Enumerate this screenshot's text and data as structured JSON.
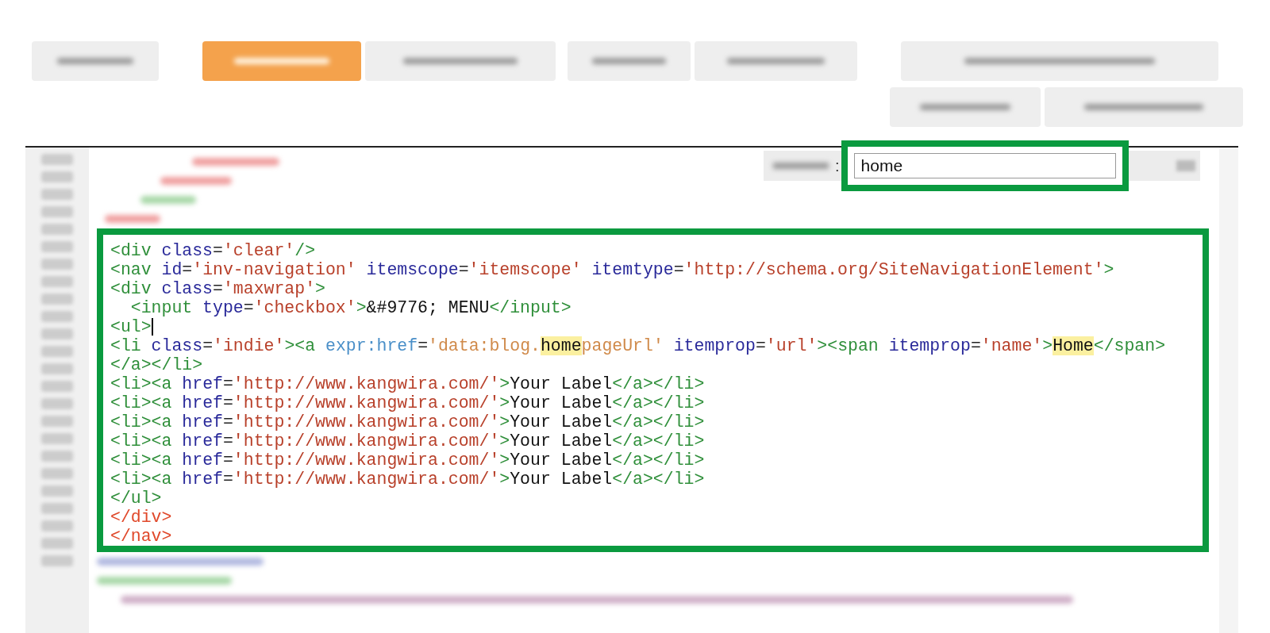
{
  "toolbar": {
    "buttons": [
      {
        "selected": false
      },
      {
        "selected": true
      },
      {
        "selected": false
      },
      {
        "selected": false
      },
      {
        "selected": false
      },
      {
        "selected": false
      }
    ],
    "second_row": [
      {
        "selected": false
      },
      {
        "selected": false
      }
    ]
  },
  "search": {
    "separator": ":",
    "value": "home"
  },
  "code_lines": [
    {
      "cursor": false,
      "tokens": [
        {
          "kind": "tag",
          "text": "<div"
        },
        {
          "kind": "attr",
          "text": " class"
        },
        {
          "kind": "punct",
          "text": "="
        },
        {
          "kind": "string",
          "text": "'clear'"
        },
        {
          "kind": "tag",
          "text": "/>"
        }
      ]
    },
    {
      "cursor": false,
      "tokens": [
        {
          "kind": "tag",
          "text": "<nav"
        },
        {
          "kind": "attr",
          "text": " id"
        },
        {
          "kind": "punct",
          "text": "="
        },
        {
          "kind": "string",
          "text": "'inv-navigation'"
        },
        {
          "kind": "attr",
          "text": " itemscope"
        },
        {
          "kind": "punct",
          "text": "="
        },
        {
          "kind": "string",
          "text": "'itemscope'"
        },
        {
          "kind": "attr",
          "text": " itemtype"
        },
        {
          "kind": "punct",
          "text": "="
        },
        {
          "kind": "string",
          "text": "'http://schema.org/SiteNavigationElement'"
        },
        {
          "kind": "tag",
          "text": ">"
        }
      ]
    },
    {
      "cursor": false,
      "tokens": [
        {
          "kind": "tag",
          "text": "<div"
        },
        {
          "kind": "attr",
          "text": " class"
        },
        {
          "kind": "punct",
          "text": "="
        },
        {
          "kind": "string",
          "text": "'maxwrap'"
        },
        {
          "kind": "tag",
          "text": ">"
        }
      ]
    },
    {
      "cursor": false,
      "tokens": [
        {
          "kind": "tag",
          "text": "  <input"
        },
        {
          "kind": "attr",
          "text": " type"
        },
        {
          "kind": "punct",
          "text": "="
        },
        {
          "kind": "string",
          "text": "'checkbox'"
        },
        {
          "kind": "tag",
          "text": ">"
        },
        {
          "kind": "text",
          "text": "&#9776; MENU"
        },
        {
          "kind": "tag",
          "text": "</input>"
        }
      ]
    },
    {
      "cursor": true,
      "tokens": [
        {
          "kind": "tag",
          "text": "<ul>"
        }
      ]
    },
    {
      "cursor": false,
      "tokens": [
        {
          "kind": "tag",
          "text": "<li"
        },
        {
          "kind": "attr",
          "text": " class"
        },
        {
          "kind": "punct",
          "text": "="
        },
        {
          "kind": "string",
          "text": "'indie'"
        },
        {
          "kind": "tag",
          "text": "><a"
        },
        {
          "kind": "expr",
          "text": " expr:href"
        },
        {
          "kind": "punct",
          "text": "="
        },
        {
          "kind": "expr_string",
          "text": "'data:blog."
        },
        {
          "kind": "match",
          "text": "home"
        },
        {
          "kind": "expr_string",
          "text": "pageUrl'"
        },
        {
          "kind": "attr",
          "text": " itemprop"
        },
        {
          "kind": "punct",
          "text": "="
        },
        {
          "kind": "string",
          "text": "'url'"
        },
        {
          "kind": "tag",
          "text": "><span"
        },
        {
          "kind": "attr",
          "text": " itemprop"
        },
        {
          "kind": "punct",
          "text": "="
        },
        {
          "kind": "string",
          "text": "'name'"
        },
        {
          "kind": "tag",
          "text": ">"
        },
        {
          "kind": "match",
          "text": "Home"
        },
        {
          "kind": "tag",
          "text": "</span>"
        }
      ]
    },
    {
      "cursor": false,
      "tokens": [
        {
          "kind": "tag",
          "text": "</a></li>"
        }
      ]
    },
    {
      "cursor": false,
      "tokens": [
        {
          "kind": "tag",
          "text": "<li><a"
        },
        {
          "kind": "attr",
          "text": " href"
        },
        {
          "kind": "punct",
          "text": "="
        },
        {
          "kind": "string",
          "text": "'http://www.kangwira.com/'"
        },
        {
          "kind": "tag",
          "text": ">"
        },
        {
          "kind": "text",
          "text": "Your Label"
        },
        {
          "kind": "tag",
          "text": "</a></li>"
        }
      ]
    },
    {
      "cursor": false,
      "tokens": [
        {
          "kind": "tag",
          "text": "<li><a"
        },
        {
          "kind": "attr",
          "text": " href"
        },
        {
          "kind": "punct",
          "text": "="
        },
        {
          "kind": "string",
          "text": "'http://www.kangwira.com/'"
        },
        {
          "kind": "tag",
          "text": ">"
        },
        {
          "kind": "text",
          "text": "Your Label"
        },
        {
          "kind": "tag",
          "text": "</a></li>"
        }
      ]
    },
    {
      "cursor": false,
      "tokens": [
        {
          "kind": "tag",
          "text": "<li><a"
        },
        {
          "kind": "attr",
          "text": " href"
        },
        {
          "kind": "punct",
          "text": "="
        },
        {
          "kind": "string",
          "text": "'http://www.kangwira.com/'"
        },
        {
          "kind": "tag",
          "text": ">"
        },
        {
          "kind": "text",
          "text": "Your Label"
        },
        {
          "kind": "tag",
          "text": "</a></li>"
        }
      ]
    },
    {
      "cursor": false,
      "tokens": [
        {
          "kind": "tag",
          "text": "<li><a"
        },
        {
          "kind": "attr",
          "text": " href"
        },
        {
          "kind": "punct",
          "text": "="
        },
        {
          "kind": "string",
          "text": "'http://www.kangwira.com/'"
        },
        {
          "kind": "tag",
          "text": ">"
        },
        {
          "kind": "text",
          "text": "Your Label"
        },
        {
          "kind": "tag",
          "text": "</a></li>"
        }
      ]
    },
    {
      "cursor": false,
      "tokens": [
        {
          "kind": "tag",
          "text": "<li><a"
        },
        {
          "kind": "attr",
          "text": " href"
        },
        {
          "kind": "punct",
          "text": "="
        },
        {
          "kind": "string",
          "text": "'http://www.kangwira.com/'"
        },
        {
          "kind": "tag",
          "text": ">"
        },
        {
          "kind": "text",
          "text": "Your Label"
        },
        {
          "kind": "tag",
          "text": "</a></li>"
        }
      ]
    },
    {
      "cursor": false,
      "tokens": [
        {
          "kind": "tag",
          "text": "<li><a"
        },
        {
          "kind": "attr",
          "text": " href"
        },
        {
          "kind": "punct",
          "text": "="
        },
        {
          "kind": "string",
          "text": "'http://www.kangwira.com/'"
        },
        {
          "kind": "tag",
          "text": ">"
        },
        {
          "kind": "text",
          "text": "Your Label"
        },
        {
          "kind": "tag",
          "text": "</a></li>"
        }
      ]
    },
    {
      "cursor": false,
      "tokens": [
        {
          "kind": "tag",
          "text": "</ul>"
        }
      ]
    },
    {
      "cursor": false,
      "tokens": [
        {
          "kind": "end_tag",
          "text": "</div>"
        }
      ]
    },
    {
      "cursor": false,
      "tokens": [
        {
          "kind": "end_tag",
          "text": "</nav>"
        }
      ]
    }
  ]
}
